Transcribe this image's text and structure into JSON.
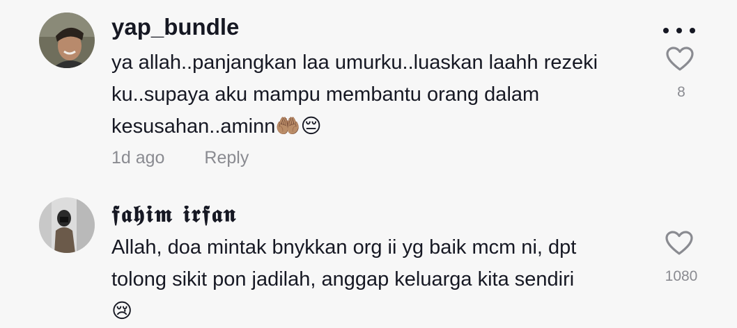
{
  "comments": [
    {
      "username": "yap_bundle",
      "text_lines": [
        "ya allah..panjangkan laa umurku..luaskan laahh rezeki",
        "ku..supaya aku mampu membantu orang dalam",
        "kesusahan..aminn🤲🏽😔"
      ],
      "time": "1d ago",
      "reply_label": "Reply",
      "likes": "8",
      "icons": {
        "more": "more-dots-icon",
        "like": "heart-outline-icon"
      }
    },
    {
      "username": "𝖋𝖆𝖍𝖎𝖒 𝖎𝖗𝖋𝖆𝖓",
      "text_lines": [
        "Allah, doa mintak bnykkan org ii yg baik mcm ni, dpt",
        "tolong sikit pon jadilah, anggap keluarga kita sendiri",
        "😢"
      ],
      "likes": "1080",
      "icons": {
        "like": "heart-outline-icon"
      }
    }
  ],
  "colors": {
    "background": "#f7f7f7",
    "text": "#161823",
    "muted": "#8a8b91"
  }
}
